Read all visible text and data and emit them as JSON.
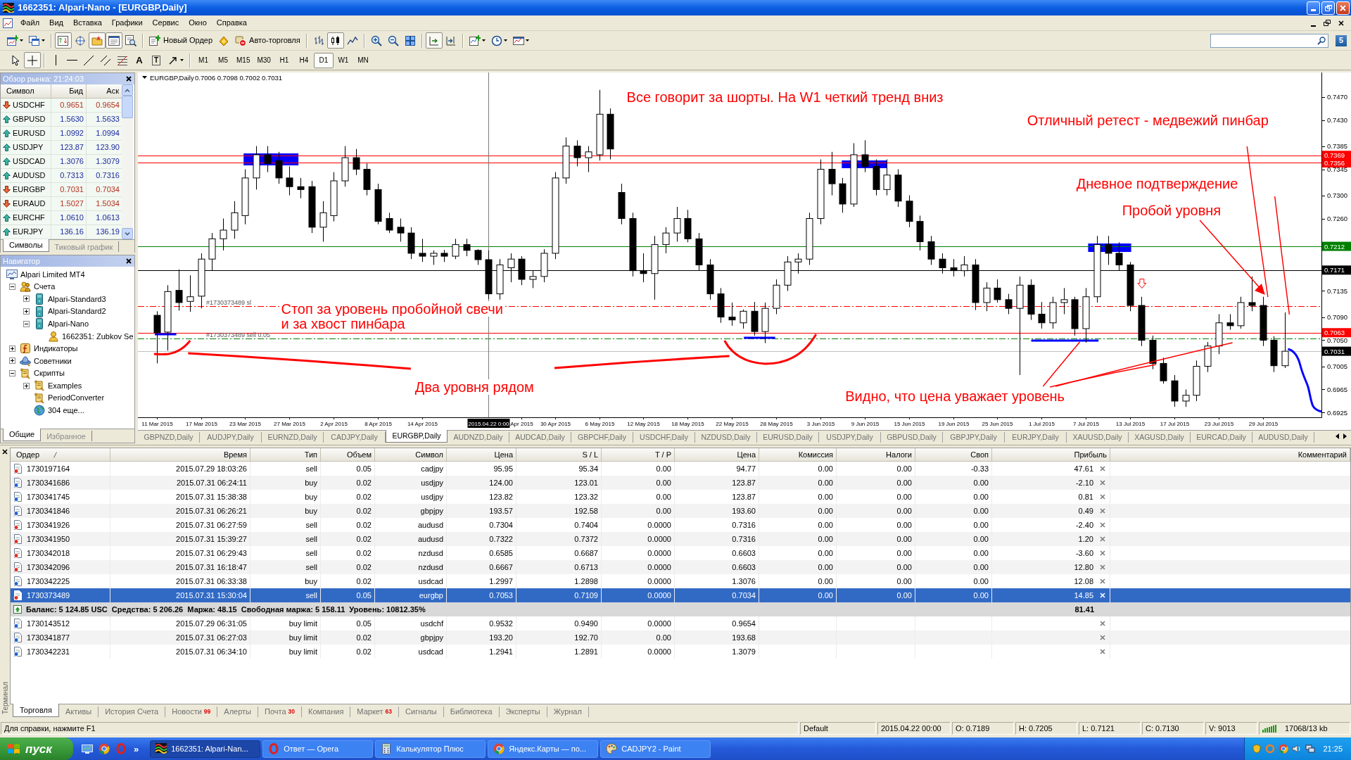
{
  "window": {
    "title": "1662351: Alpari-Nano - [EURGBP,Daily]"
  },
  "menu": [
    "Файл",
    "Вид",
    "Вставка",
    "Графики",
    "Сервис",
    "Окно",
    "Справка"
  ],
  "toolbar": {
    "panels": [
      {
        "kind": "market-watch",
        "on": true
      },
      {
        "kind": "data-window",
        "on": false
      },
      {
        "kind": "navigator",
        "on": true
      },
      {
        "kind": "terminal",
        "on": true
      },
      {
        "kind": "tester",
        "on": false
      }
    ],
    "new_order": "Новый Ордер",
    "auto_trading": {
      "label": "Авто-торговля",
      "on": false
    },
    "chart_types": [
      {
        "kind": "bars",
        "selected": false
      },
      {
        "kind": "candles",
        "selected": true
      },
      {
        "kind": "line",
        "selected": false
      }
    ],
    "toggles": [
      {
        "kind": "autoscroll",
        "on": true
      },
      {
        "kind": "chart-shift",
        "on": false
      }
    ],
    "community": "5"
  },
  "drawing_tools": [
    {
      "kind": "cursor",
      "selected": false
    },
    {
      "kind": "crosshair",
      "selected": true
    },
    {
      "kind": "vline",
      "selected": false
    },
    {
      "kind": "hline",
      "selected": false
    },
    {
      "kind": "trendline",
      "selected": false
    },
    {
      "kind": "channel",
      "selected": false
    },
    {
      "kind": "fibo",
      "selected": false
    },
    {
      "kind": "text",
      "glyph": "A",
      "selected": false
    },
    {
      "kind": "label",
      "glyph": "T",
      "selected": false
    },
    {
      "kind": "arrows",
      "selected": false
    }
  ],
  "periods": [
    {
      "label": "M1",
      "selected": false
    },
    {
      "label": "M5",
      "selected": false
    },
    {
      "label": "M15",
      "selected": false
    },
    {
      "label": "M30",
      "selected": false
    },
    {
      "label": "H1",
      "selected": false
    },
    {
      "label": "H4",
      "selected": false
    },
    {
      "label": "D1",
      "selected": true
    },
    {
      "label": "W1",
      "selected": false
    },
    {
      "label": "MN",
      "selected": false
    }
  ],
  "market_watch": {
    "title": "Обзор рынка: 21:24:03",
    "columns": [
      "Символ",
      "Бид",
      "Аск"
    ],
    "rows": [
      {
        "symbol": "USDCHF",
        "bid": "0.9651",
        "ask": "0.9654",
        "rising": false
      },
      {
        "symbol": "GBPUSD",
        "bid": "1.5630",
        "ask": "1.5633",
        "rising": true
      },
      {
        "symbol": "EURUSD",
        "bid": "1.0992",
        "ask": "1.0994",
        "rising": true
      },
      {
        "symbol": "USDJPY",
        "bid": "123.87",
        "ask": "123.90",
        "rising": true
      },
      {
        "symbol": "USDCAD",
        "bid": "1.3076",
        "ask": "1.3079",
        "rising": true
      },
      {
        "symbol": "AUDUSD",
        "bid": "0.7313",
        "ask": "0.7316",
        "rising": true
      },
      {
        "symbol": "EURGBP",
        "bid": "0.7031",
        "ask": "0.7034",
        "rising": false
      },
      {
        "symbol": "EURAUD",
        "bid": "1.5027",
        "ask": "1.5034",
        "rising": false
      },
      {
        "symbol": "EURCHF",
        "bid": "1.0610",
        "ask": "1.0613",
        "rising": true
      },
      {
        "symbol": "EURJPY",
        "bid": "136.16",
        "ask": "136.19",
        "rising": true
      }
    ],
    "tabs": [
      {
        "label": "Символы",
        "selected": true
      },
      {
        "label": "Тиковый график",
        "selected": false
      }
    ]
  },
  "navigator": {
    "title": "Навигатор",
    "tree": [
      {
        "label": "Alpari Limited MT4",
        "kind": "broker",
        "children": [
          {
            "label": "Счета",
            "kind": "accounts",
            "expanded": true,
            "children": [
              {
                "label": "Alpari-Standard3",
                "kind": "server",
                "expanded": false
              },
              {
                "label": "Alpari-Standard2",
                "kind": "server",
                "expanded": false
              },
              {
                "label": "Alpari-Nano",
                "kind": "server",
                "expanded": true,
                "children": [
                  {
                    "label": "1662351: Zubkov Se",
                    "kind": "account"
                  }
                ]
              }
            ]
          },
          {
            "label": "Индикаторы",
            "kind": "indicators",
            "expanded": false
          },
          {
            "label": "Советники",
            "kind": "experts",
            "expanded": false
          },
          {
            "label": "Скрипты",
            "kind": "scripts",
            "expanded": true,
            "children": [
              {
                "label": "Examples",
                "kind": "script-folder",
                "expanded": false
              },
              {
                "label": "PeriodConverter",
                "kind": "script"
              },
              {
                "label": "304 еще...",
                "kind": "more"
              }
            ]
          }
        ]
      }
    ],
    "tabs": [
      {
        "label": "Общие",
        "selected": true
      },
      {
        "label": "Избранное",
        "selected": false
      }
    ]
  },
  "chart": {
    "chart_data": [
      {
        "type": "candlestick",
        "title": "EURGBP,Daily",
        "subtitle": "0.7006 0.7098 0.7002 0.7031",
        "categories": [
          "11 Mar 2015",
          null,
          null,
          null,
          "17 Mar 2015",
          null,
          null,
          null,
          "23 Mar 2015",
          null,
          null,
          null,
          "27 Mar 2015",
          null,
          null,
          null,
          "2 Apr 2015",
          null,
          null,
          null,
          "8 Apr 2015",
          null,
          null,
          null,
          "14 Apr 2015",
          null,
          null,
          null,
          null,
          null,
          null,
          null,
          null,
          "Apr 2015",
          null,
          null,
          "30 Apr 2015",
          null,
          null,
          null,
          "6 May 2015",
          null,
          null,
          null,
          "12 May 2015",
          null,
          null,
          null,
          "18 May 2015",
          null,
          null,
          null,
          "22 May 2015",
          null,
          null,
          null,
          "28 May 2015",
          null,
          null,
          null,
          "3 Jun 2015",
          null,
          null,
          null,
          "9 Jun 2015",
          null,
          null,
          null,
          "15 Jun 2015",
          null,
          null,
          null,
          "19 Jun 2015",
          null,
          null,
          null,
          "25 Jun 2015",
          null,
          null,
          null,
          "1 Jul 2015",
          null,
          null,
          null,
          "7 Jul 2015",
          null,
          null,
          null,
          "13 Jul 2015",
          null,
          null,
          null,
          "17 Jul 2015",
          null,
          null,
          null,
          "23 Jul 2015",
          null,
          null,
          null,
          "29 Jul 2015",
          null,
          null
        ],
        "ohlc": [
          [
            0.7093,
            0.71,
            0.701,
            0.7063
          ],
          [
            0.7064,
            0.7145,
            0.7032,
            0.7134
          ],
          [
            0.7136,
            0.7172,
            0.7101,
            0.7115
          ],
          [
            0.7117,
            0.7162,
            0.7099,
            0.7125
          ],
          [
            0.7126,
            0.72,
            0.7105,
            0.719
          ],
          [
            0.719,
            0.7235,
            0.717,
            0.7225
          ],
          [
            0.7225,
            0.726,
            0.7205,
            0.724
          ],
          [
            0.724,
            0.729,
            0.7225,
            0.727
          ],
          [
            0.7265,
            0.7345,
            0.725,
            0.733
          ],
          [
            0.733,
            0.7385,
            0.731,
            0.737
          ],
          [
            0.737,
            0.7385,
            0.734,
            0.7355
          ],
          [
            0.736,
            0.7375,
            0.732,
            0.733
          ],
          [
            0.733,
            0.735,
            0.73,
            0.7315
          ],
          [
            0.7315,
            0.733,
            0.7295,
            0.731
          ],
          [
            0.7315,
            0.7325,
            0.7235,
            0.7245
          ],
          [
            0.7245,
            0.729,
            0.722,
            0.727
          ],
          [
            0.7265,
            0.734,
            0.7255,
            0.7325
          ],
          [
            0.7325,
            0.7385,
            0.7315,
            0.7365
          ],
          [
            0.7365,
            0.738,
            0.7335,
            0.7345
          ],
          [
            0.7345,
            0.7355,
            0.73,
            0.731
          ],
          [
            0.731,
            0.732,
            0.725,
            0.7255
          ],
          [
            0.726,
            0.727,
            0.7235,
            0.724
          ],
          [
            0.7245,
            0.726,
            0.722,
            0.7235
          ],
          [
            0.7235,
            0.7245,
            0.719,
            0.72
          ],
          [
            0.72,
            0.7225,
            0.7185,
            0.7195
          ],
          [
            0.7195,
            0.7205,
            0.718,
            0.72
          ],
          [
            0.72,
            0.7206,
            0.7185,
            0.7195
          ],
          [
            0.7195,
            0.7225,
            0.719,
            0.7215
          ],
          [
            0.7215,
            0.7225,
            0.7195,
            0.7205
          ],
          [
            0.7205,
            0.7207,
            0.718,
            0.7189
          ],
          [
            0.7189,
            0.7205,
            0.7121,
            0.713
          ],
          [
            0.713,
            0.719,
            0.712,
            0.718
          ],
          [
            0.7175,
            0.72,
            0.715,
            0.719
          ],
          [
            0.719,
            0.7195,
            0.7145,
            0.7155
          ],
          [
            0.7155,
            0.717,
            0.714,
            0.716
          ],
          [
            0.716,
            0.7207,
            0.715,
            0.72
          ],
          [
            0.72,
            0.734,
            0.719,
            0.733
          ],
          [
            0.733,
            0.74,
            0.732,
            0.7385
          ],
          [
            0.7385,
            0.7395,
            0.735,
            0.7365
          ],
          [
            0.7365,
            0.7385,
            0.734,
            0.7375
          ],
          [
            0.737,
            0.7482,
            0.736,
            0.744
          ],
          [
            0.744,
            0.745,
            0.7362,
            0.738
          ],
          [
            0.7305,
            0.732,
            0.725,
            0.726
          ],
          [
            0.726,
            0.727,
            0.716,
            0.717
          ],
          [
            0.717,
            0.72,
            0.715,
            0.7165
          ],
          [
            0.7165,
            0.723,
            0.712,
            0.7215
          ],
          [
            0.7215,
            0.7245,
            0.72,
            0.7235
          ],
          [
            0.7235,
            0.728,
            0.722,
            0.726
          ],
          [
            0.726,
            0.7275,
            0.7219,
            0.7225
          ],
          [
            0.7225,
            0.7235,
            0.717,
            0.718
          ],
          [
            0.718,
            0.719,
            0.712,
            0.713
          ],
          [
            0.713,
            0.714,
            0.708,
            0.709
          ],
          [
            0.709,
            0.7115,
            0.7075,
            0.7085
          ],
          [
            0.708,
            0.7103,
            0.707,
            0.71
          ],
          [
            0.71,
            0.7116,
            0.7058,
            0.7065
          ],
          [
            0.7065,
            0.7115,
            0.7045,
            0.7105
          ],
          [
            0.7105,
            0.7155,
            0.7095,
            0.7145
          ],
          [
            0.7145,
            0.7195,
            0.7135,
            0.7185
          ],
          [
            0.7185,
            0.72,
            0.7165,
            0.719
          ],
          [
            0.719,
            0.727,
            0.718,
            0.726
          ],
          [
            0.726,
            0.7362,
            0.725,
            0.7345
          ],
          [
            0.7345,
            0.7375,
            0.73,
            0.732
          ],
          [
            0.732,
            0.733,
            0.727,
            0.7285
          ],
          [
            0.7285,
            0.739,
            0.728,
            0.737
          ],
          [
            0.737,
            0.7395,
            0.734,
            0.735
          ],
          [
            0.735,
            0.7362,
            0.73,
            0.731
          ],
          [
            0.731,
            0.7362,
            0.73,
            0.7335
          ],
          [
            0.7335,
            0.7345,
            0.728,
            0.729
          ],
          [
            0.729,
            0.73,
            0.7245,
            0.7255
          ],
          [
            0.7255,
            0.7265,
            0.7205,
            0.722
          ],
          [
            0.722,
            0.723,
            0.718,
            0.719
          ],
          [
            0.719,
            0.72,
            0.7165,
            0.7175
          ],
          [
            0.7175,
            0.719,
            0.716,
            0.717
          ],
          [
            0.717,
            0.7195,
            0.716,
            0.718
          ],
          [
            0.718,
            0.719,
            0.7102,
            0.7115
          ],
          [
            0.7115,
            0.715,
            0.71,
            0.714
          ],
          [
            0.714,
            0.7155,
            0.7115,
            0.712
          ],
          [
            0.712,
            0.713,
            0.7095,
            0.7105
          ],
          [
            0.7105,
            0.716,
            0.699,
            0.7145
          ],
          [
            0.7145,
            0.7155,
            0.7085,
            0.7095
          ],
          [
            0.7095,
            0.7116,
            0.707,
            0.708
          ],
          [
            0.708,
            0.7125,
            0.707,
            0.7115
          ],
          [
            0.7115,
            0.714,
            0.7095,
            0.712
          ],
          [
            0.712,
            0.7125,
            0.7058,
            0.707
          ],
          [
            0.707,
            0.714,
            0.7046,
            0.7125
          ],
          [
            0.7125,
            0.723,
            0.7115,
            0.7215
          ],
          [
            0.7215,
            0.723,
            0.718,
            0.72
          ],
          [
            0.72,
            0.7219,
            0.717,
            0.718
          ],
          [
            0.718,
            0.7185,
            0.71,
            0.711
          ],
          [
            0.711,
            0.7125,
            0.704,
            0.705
          ],
          [
            0.705,
            0.7058,
            0.7,
            0.701
          ],
          [
            0.701,
            0.702,
            0.6975,
            0.698
          ],
          [
            0.698,
            0.699,
            0.6935,
            0.6945
          ],
          [
            0.6945,
            0.6965,
            0.6935,
            0.6955
          ],
          [
            0.6955,
            0.7015,
            0.6945,
            0.7005
          ],
          [
            0.7005,
            0.7047,
            0.6995,
            0.704
          ],
          [
            0.704,
            0.7095,
            0.7026,
            0.708
          ],
          [
            0.708,
            0.7095,
            0.7068,
            0.7075
          ],
          [
            0.7075,
            0.7125,
            0.707,
            0.7115
          ],
          [
            0.7115,
            0.716,
            0.71,
            0.711
          ],
          [
            0.711,
            0.7125,
            0.704,
            0.705
          ],
          [
            0.705,
            0.7057,
            0.6995,
            0.7006
          ],
          [
            0.7006,
            0.7098,
            0.7002,
            0.7031
          ]
        ],
        "ylim": [
          0.6917,
          0.7512
        ],
        "yticks": [
          {
            "value": 0.747,
            "label": "0.7470"
          },
          {
            "value": 0.743,
            "label": "0.7430"
          },
          {
            "value": 0.7385,
            "label": "0.7385"
          },
          {
            "value": 0.7345,
            "label": "0.7345"
          },
          {
            "value": 0.73,
            "label": "0.7300"
          },
          {
            "value": 0.726,
            "label": "0.7260"
          },
          {
            "value": 0.7135,
            "label": "0.7135"
          },
          {
            "value": 0.709,
            "label": "0.7090"
          },
          {
            "value": 0.705,
            "label": "0.7050"
          },
          {
            "value": 0.7005,
            "label": "0.7005"
          },
          {
            "value": 0.6965,
            "label": "0.6965"
          },
          {
            "value": 0.6925,
            "label": "0.6925"
          }
        ],
        "ref_lines": [
          {
            "axis": "y",
            "value": 0.7369,
            "label": "0.7369",
            "color": "#ff0000"
          },
          {
            "axis": "y",
            "value": 0.7356,
            "label": "0.7356",
            "color": "#ff0000"
          },
          {
            "axis": "y",
            "value": 0.7212,
            "label": "0.7212",
            "color": "#008000"
          },
          {
            "axis": "y",
            "value": 0.7171,
            "label": "0.7171",
            "color": "#000000"
          },
          {
            "axis": "y",
            "value": 0.7109,
            "label": "#1730373489 sl",
            "color": "#ff0000",
            "line_style": "dashdot"
          },
          {
            "axis": "y",
            "value": 0.7063,
            "label": "0.7063",
            "color": "#ff0000"
          },
          {
            "axis": "y",
            "value": 0.7053,
            "label": "#1730373489 sell 0.05",
            "color": "#008000",
            "line_style": "dashdot"
          },
          {
            "axis": "y",
            "value": 0.7031,
            "label": "0.7031",
            "color": "#c0c0c0"
          }
        ],
        "annotations": [
          "Все говорит за шорты. На W1 четкий тренд вниз",
          "Отличный ретест - медвежий пинбар",
          "Дневное подтверждение",
          "Пробой уровня",
          "Стоп за уровень пробойной свечи",
          "и за хвост пинбара",
          "Два уровня рядом",
          "Видно, что цена уважает уровень"
        ]
      }
    ],
    "crosshair": {
      "label": "2015.04.22 0:00"
    },
    "tabs": [
      {
        "label": "GBPNZD,Daily",
        "selected": false
      },
      {
        "label": "AUDJPY,Daily",
        "selected": false
      },
      {
        "label": "EURNZD,Daily",
        "selected": false
      },
      {
        "label": "CADJPY,Daily",
        "selected": false
      },
      {
        "label": "EURGBP,Daily",
        "selected": true
      },
      {
        "label": "AUDNZD,Daily",
        "selected": false
      },
      {
        "label": "AUDCAD,Daily",
        "selected": false
      },
      {
        "label": "GBPCHF,Daily",
        "selected": false
      },
      {
        "label": "USDCHF,Daily",
        "selected": false
      },
      {
        "label": "NZDUSD,Daily",
        "selected": false
      },
      {
        "label": "EURUSD,Daily",
        "selected": false
      },
      {
        "label": "USDJPY,Daily",
        "selected": false
      },
      {
        "label": "GBPUSD,Daily",
        "selected": false
      },
      {
        "label": "GBPJPY,Daily",
        "selected": false
      },
      {
        "label": "EURJPY,Daily",
        "selected": false
      },
      {
        "label": "XAUUSD,Daily",
        "selected": false
      },
      {
        "label": "XAGUSD,Daily",
        "selected": false
      },
      {
        "label": "EURCAD,Daily",
        "selected": false
      },
      {
        "label": "AUDUSD,Daily",
        "selected": false
      }
    ]
  },
  "terminal": {
    "title": "Терминал",
    "columns": [
      "Ордер",
      "Время",
      "Тип",
      "Объем",
      "Символ",
      "Цена",
      "S / L",
      "T / P",
      "Цена",
      "Комиссия",
      "Налоги",
      "Своп",
      "Прибыль",
      "Комментарий"
    ],
    "positions": [
      {
        "kind": "sell",
        "selected": false,
        "cells": [
          "1730197164",
          "2015.07.29 18:03:26",
          "sell",
          "0.05",
          "cadjpy",
          "95.95",
          "95.34",
          "0.00",
          "94.77",
          "0.00",
          "0.00",
          "-0.33",
          "47.61"
        ]
      },
      {
        "kind": "buy",
        "selected": false,
        "cells": [
          "1730341686",
          "2015.07.31 06:24:11",
          "buy",
          "0.02",
          "usdjpy",
          "124.00",
          "123.01",
          "0.00",
          "123.87",
          "0.00",
          "0.00",
          "0.00",
          "-2.10"
        ]
      },
      {
        "kind": "buy",
        "selected": false,
        "cells": [
          "1730341745",
          "2015.07.31 15:38:38",
          "buy",
          "0.02",
          "usdjpy",
          "123.82",
          "123.32",
          "0.00",
          "123.87",
          "0.00",
          "0.00",
          "0.00",
          "0.81"
        ]
      },
      {
        "kind": "buy",
        "selected": false,
        "cells": [
          "1730341846",
          "2015.07.31 06:26:21",
          "buy",
          "0.02",
          "gbpjpy",
          "193.57",
          "192.58",
          "0.00",
          "193.60",
          "0.00",
          "0.00",
          "0.00",
          "0.49"
        ]
      },
      {
        "kind": "sell",
        "selected": false,
        "cells": [
          "1730341926",
          "2015.07.31 06:27:59",
          "sell",
          "0.02",
          "audusd",
          "0.7304",
          "0.7404",
          "0.0000",
          "0.7316",
          "0.00",
          "0.00",
          "0.00",
          "-2.40"
        ]
      },
      {
        "kind": "sell",
        "selected": false,
        "cells": [
          "1730341950",
          "2015.07.31 15:39:27",
          "sell",
          "0.02",
          "audusd",
          "0.7322",
          "0.7372",
          "0.0000",
          "0.7316",
          "0.00",
          "0.00",
          "0.00",
          "1.20"
        ]
      },
      {
        "kind": "sell",
        "selected": false,
        "cells": [
          "1730342018",
          "2015.07.31 06:29:43",
          "sell",
          "0.02",
          "nzdusd",
          "0.6585",
          "0.6687",
          "0.0000",
          "0.6603",
          "0.00",
          "0.00",
          "0.00",
          "-3.60"
        ]
      },
      {
        "kind": "sell",
        "selected": false,
        "cells": [
          "1730342096",
          "2015.07.31 16:18:47",
          "sell",
          "0.02",
          "nzdusd",
          "0.6667",
          "0.6713",
          "0.0000",
          "0.6603",
          "0.00",
          "0.00",
          "0.00",
          "12.80"
        ]
      },
      {
        "kind": "buy",
        "selected": false,
        "cells": [
          "1730342225",
          "2015.07.31 06:33:38",
          "buy",
          "0.02",
          "usdcad",
          "1.2997",
          "1.2898",
          "0.0000",
          "1.3076",
          "0.00",
          "0.00",
          "0.00",
          "12.08"
        ]
      },
      {
        "kind": "sell",
        "selected": true,
        "cells": [
          "1730373489",
          "2015.07.31 15:30:04",
          "sell",
          "0.05",
          "eurgbp",
          "0.7053",
          "0.7109",
          "0.0000",
          "0.7034",
          "0.00",
          "0.00",
          "0.00",
          "14.85"
        ]
      }
    ],
    "summary": {
      "text": "Баланс: 5 124.85 USC  Средства: 5 206.26  Маржа: 48.15  Свободная маржа: 5 158.11  Уровень: 10812.35%",
      "profit": "81.41"
    },
    "orders": [
      {
        "kind": "buy",
        "selected": false,
        "cells": [
          "1730143512",
          "2015.07.29 06:31:05",
          "buy limit",
          "0.05",
          "usdchf",
          "0.9532",
          "0.9490",
          "0.0000",
          "0.9654"
        ]
      },
      {
        "kind": "buy",
        "selected": false,
        "cells": [
          "1730341877",
          "2015.07.31 06:27:03",
          "buy limit",
          "0.02",
          "gbpjpy",
          "193.20",
          "192.70",
          "0.00",
          "193.68"
        ]
      },
      {
        "kind": "buy",
        "selected": false,
        "cells": [
          "1730342231",
          "2015.07.31 06:34:10",
          "buy limit",
          "0.02",
          "usdcad",
          "1.2941",
          "1.2891",
          "0.0000",
          "1.3079"
        ]
      }
    ],
    "tabs": [
      {
        "label": "Торговля",
        "selected": true
      },
      {
        "label": "Активы",
        "selected": false
      },
      {
        "label": "История Счета",
        "selected": false
      },
      {
        "label": "Новости",
        "count": "99",
        "selected": false
      },
      {
        "label": "Алерты",
        "selected": false
      },
      {
        "label": "Почта",
        "count": "30",
        "selected": false
      },
      {
        "label": "Компания",
        "selected": false
      },
      {
        "label": "Маркет",
        "count": "63",
        "selected": false
      },
      {
        "label": "Сигналы",
        "selected": false
      },
      {
        "label": "Библиотека",
        "selected": false
      },
      {
        "label": "Эксперты",
        "selected": false
      },
      {
        "label": "Журнал",
        "selected": false
      }
    ]
  },
  "status_bar": {
    "help": "Для справки, нажмите F1",
    "profile": "Default",
    "time": "2015.04.22 00:00",
    "open": "O: 0.7189",
    "high": "H: 0.7205",
    "low": "L: 0.7121",
    "close": "C: 0.7130",
    "volume": "V: 9013",
    "traffic": "17068/13 kb"
  },
  "taskbar": {
    "start": "пуск",
    "more": "»",
    "tasks": [
      {
        "kind": "terminal",
        "label": "1662351: Alpari-Nan...",
        "selected": true
      },
      {
        "kind": "opera",
        "label": "Ответ — Opera",
        "selected": false
      },
      {
        "kind": "calculator",
        "label": "Калькулятор Плюс",
        "selected": false
      },
      {
        "kind": "chrome",
        "label": "Яндекс.Карты — по...",
        "selected": false
      },
      {
        "kind": "paint",
        "label": "CADJPY2 - Paint",
        "selected": false
      }
    ],
    "clock": "21:25"
  }
}
